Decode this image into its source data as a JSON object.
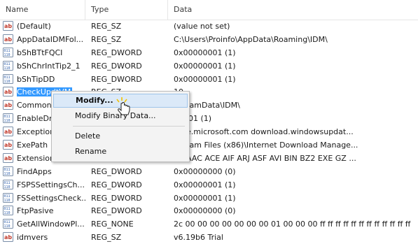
{
  "columns": {
    "name": "Name",
    "type": "Type",
    "data": "Data"
  },
  "rows": [
    {
      "name": "(Default)",
      "type": "REG_SZ",
      "data": "(value not set)",
      "icon": "string-value-icon"
    },
    {
      "name": "AppDataIDMFol...",
      "type": "REG_SZ",
      "data": "C:\\Users\\Proinfo\\AppData\\Roaming\\IDM\\",
      "icon": "string-value-icon"
    },
    {
      "name": "bShBTtFQCI",
      "type": "REG_DWORD",
      "data": "0x00000001 (1)",
      "icon": "binary-value-icon"
    },
    {
      "name": "bShChrIntTip2_1",
      "type": "REG_DWORD",
      "data": "0x00000001 (1)",
      "icon": "binary-value-icon"
    },
    {
      "name": "bShTipDD",
      "type": "REG_DWORD",
      "data": "0x00000001 (1)",
      "icon": "binary-value-icon"
    },
    {
      "name": "CheckUpdtVM",
      "type": "REG_SZ",
      "data": "10",
      "icon": "string-value-icon"
    },
    {
      "name": "Common",
      "type": "",
      "data": "rogramData\\IDM\\",
      "icon": "string-value-icon"
    },
    {
      "name": "EnableDr",
      "type": "",
      "data": "00001 (1)",
      "icon": "binary-value-icon"
    },
    {
      "name": "Exception",
      "type": "",
      "data": "date.microsoft.com download.windowsupdat...",
      "icon": "string-value-icon"
    },
    {
      "name": "ExePath",
      "type": "",
      "data": "rogram Files (x86)\\Internet Download Manage...",
      "icon": "string-value-icon"
    },
    {
      "name": "Extension",
      "type": "",
      "data": "7Z AAC ACE AIF ARJ ASF AVI BIN BZ2 EXE GZ ...",
      "icon": "string-value-icon"
    },
    {
      "name": "FindApps",
      "type": "REG_DWORD",
      "data": "0x00000000 (0)",
      "icon": "binary-value-icon"
    },
    {
      "name": "FSPSSettingsCh...",
      "type": "REG_DWORD",
      "data": "0x00000001 (1)",
      "icon": "binary-value-icon"
    },
    {
      "name": "FSSettingsCheck...",
      "type": "REG_DWORD",
      "data": "0x00000001 (1)",
      "icon": "binary-value-icon"
    },
    {
      "name": "FtpPasive",
      "type": "REG_DWORD",
      "data": "0x00000000 (0)",
      "icon": "binary-value-icon"
    },
    {
      "name": "GetAllWindowPl...",
      "type": "REG_NONE",
      "data": "2c 00 00 00 00 00 00 00 01 00 00 00 ff ff ff ff ff ff ff ff ff ff ff ff",
      "icon": "binary-value-icon"
    },
    {
      "name": "idmvers",
      "type": "REG_SZ",
      "data": "v6.19b6 Trial",
      "icon": "string-value-icon"
    }
  ],
  "context_menu": {
    "modify": "Modify...",
    "modify_binary": "Modify Binary Data...",
    "delete": "Delete",
    "rename": "Rename"
  }
}
